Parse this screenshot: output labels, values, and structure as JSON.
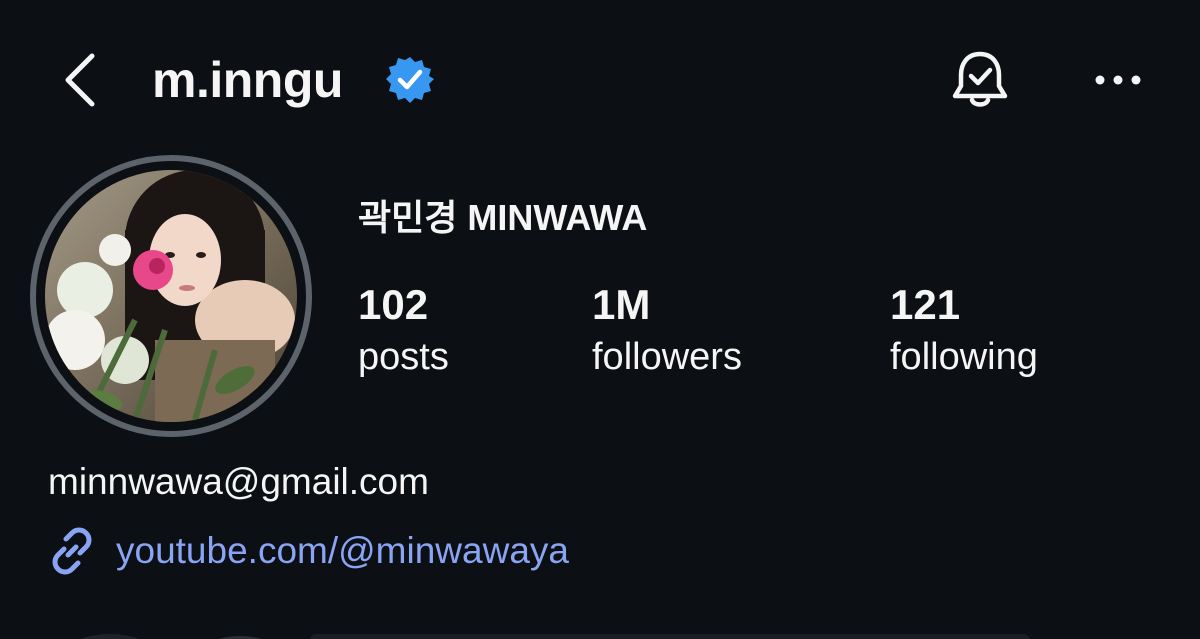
{
  "header": {
    "username": "m.inngu",
    "verified": true,
    "icons": [
      "back-chevron-icon",
      "verified-badge-icon",
      "notification-bell-icon",
      "more-options-icon"
    ]
  },
  "profile": {
    "display_name": "곽민경 MINWAWA",
    "stats": [
      {
        "value": "102",
        "label": "posts"
      },
      {
        "value": "1M",
        "label": "followers"
      },
      {
        "value": "121",
        "label": "following"
      }
    ],
    "email": "minnwawa@gmail.com",
    "link": {
      "icon": "link-icon",
      "text": "youtube.com/@minwawaya"
    }
  },
  "colors": {
    "background": "#0c0f14",
    "text": "#f5f5f5",
    "verified_badge": "#3897f0",
    "link": "#8aa4f4",
    "avatar_ring": "#5d636b"
  }
}
